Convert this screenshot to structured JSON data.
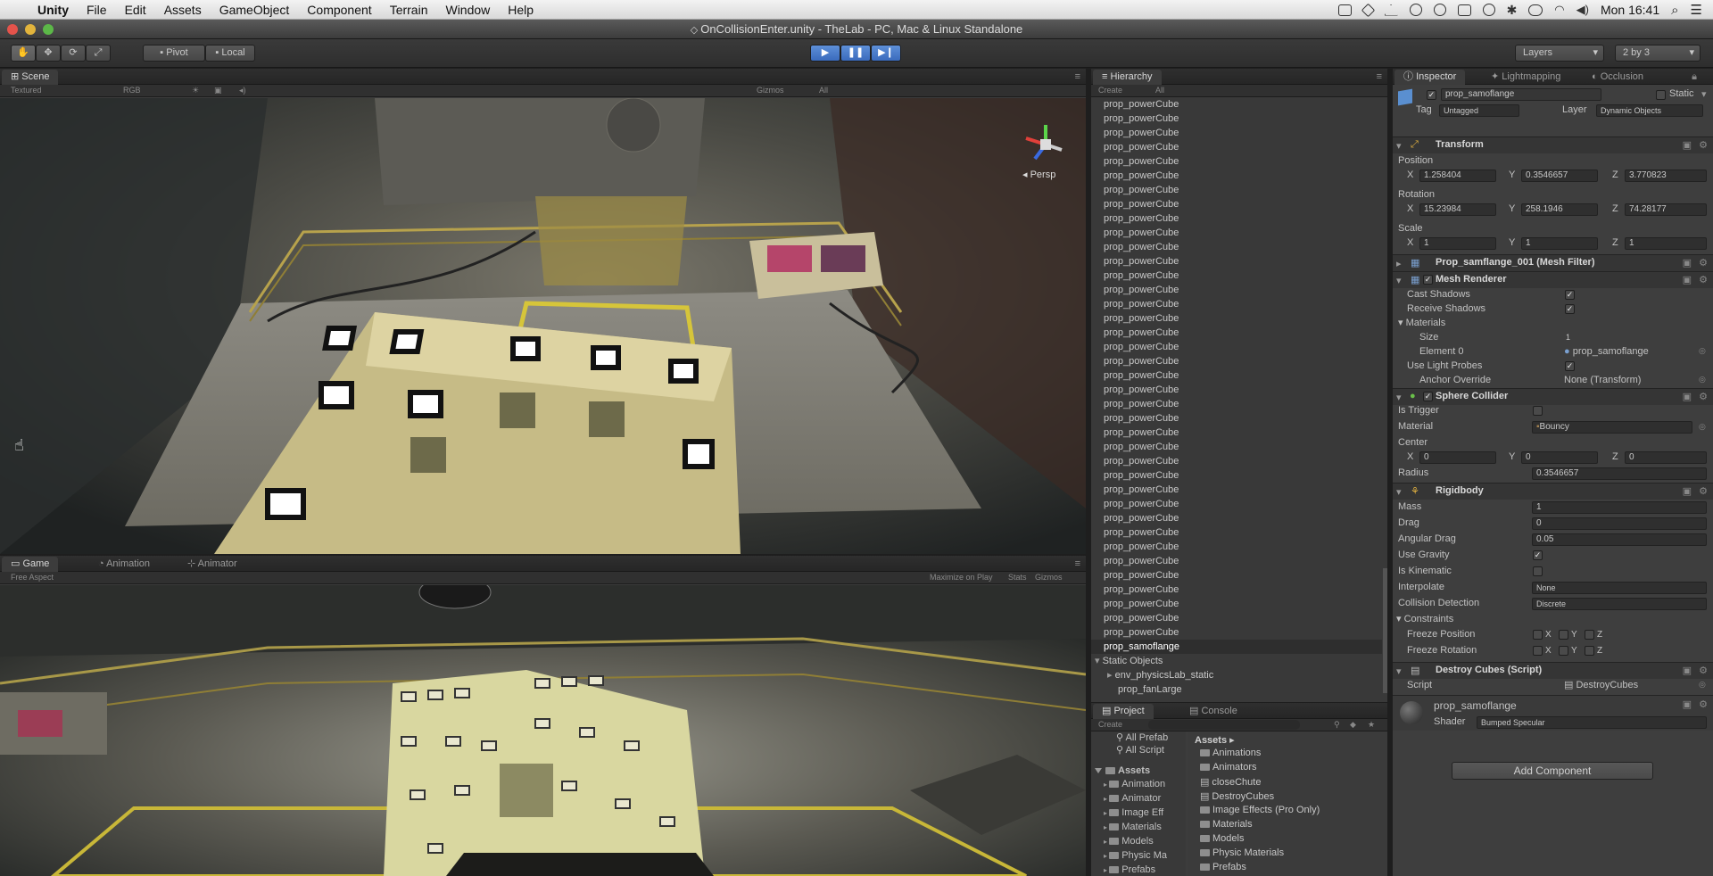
{
  "menubar": {
    "app": "Unity",
    "items": [
      "File",
      "Edit",
      "Assets",
      "GameObject",
      "Component",
      "Terrain",
      "Window",
      "Help"
    ],
    "clock": "Mon 16:41"
  },
  "window": {
    "title": "OnCollisionEnter.unity - TheLab - PC, Mac & Linux Standalone"
  },
  "toolbar": {
    "pivot": "Pivot",
    "local": "Local",
    "layers": "Layers",
    "layout": "2 by 3"
  },
  "scene": {
    "tab": "Scene",
    "render_mode": "Textured",
    "color_mode": "RGB",
    "gizmos": "Gizmos",
    "search": "All",
    "persp": "Persp"
  },
  "game": {
    "tabs": [
      "Game",
      "Animation",
      "Animator"
    ],
    "aspect": "Free Aspect",
    "maximize": "Maximize on Play",
    "stats": "Stats",
    "gizmos": "Gizmos"
  },
  "hierarchy": {
    "tab": "Hierarchy",
    "create": "Create",
    "search": "All",
    "items": [
      "prop_powerCube",
      "prop_powerCube",
      "prop_powerCube",
      "prop_powerCube",
      "prop_powerCube",
      "prop_powerCube",
      "prop_powerCube",
      "prop_powerCube",
      "prop_powerCube",
      "prop_powerCube",
      "prop_powerCube",
      "prop_powerCube",
      "prop_powerCube",
      "prop_powerCube",
      "prop_powerCube",
      "prop_powerCube",
      "prop_powerCube",
      "prop_powerCube",
      "prop_powerCube",
      "prop_powerCube",
      "prop_powerCube",
      "prop_powerCube",
      "prop_powerCube",
      "prop_powerCube",
      "prop_powerCube",
      "prop_powerCube",
      "prop_powerCube",
      "prop_powerCube",
      "prop_powerCube",
      "prop_powerCube",
      "prop_powerCube",
      "prop_powerCube",
      "prop_powerCube",
      "prop_powerCube",
      "prop_powerCube",
      "prop_powerCube",
      "prop_powerCube",
      "prop_powerCube"
    ],
    "selected": "prop_samoflange",
    "static_group": "Static Objects",
    "static_children": [
      "env_physicsLab_static",
      "prop_fanLarge"
    ]
  },
  "project": {
    "tabs": [
      "Project",
      "Console"
    ],
    "create": "Create",
    "favorites": [
      "All Prefab",
      "All Script"
    ],
    "tree_root": "Assets",
    "tree": [
      "Animation",
      "Animator",
      "Image Eff",
      "Materials",
      "Models",
      "Physic Ma",
      "Prefabs"
    ],
    "breadcrumb": "Assets",
    "files": [
      "Animations",
      "Animators",
      "closeChute",
      "DestroyCubes",
      "Image Effects (Pro Only)",
      "Materials",
      "Models",
      "Physic Materials",
      "Prefabs"
    ]
  },
  "inspector": {
    "tabs": [
      "Inspector",
      "Lightmapping",
      "Occlusion"
    ],
    "object_name": "prop_samoflange",
    "static": "Static",
    "tag_label": "Tag",
    "tag": "Untagged",
    "layer_label": "Layer",
    "layer": "Dynamic Objects",
    "transform": {
      "title": "Transform",
      "position_label": "Position",
      "position": {
        "x": "1.258404",
        "y": "0.3546657",
        "z": "3.770823"
      },
      "rotation_label": "Rotation",
      "rotation": {
        "x": "15.23984",
        "y": "258.1946",
        "z": "74.28177"
      },
      "scale_label": "Scale",
      "scale": {
        "x": "1",
        "y": "1",
        "z": "1"
      }
    },
    "mesh_filter": "Prop_samflange_001 (Mesh Filter)",
    "mesh_renderer": {
      "title": "Mesh Renderer",
      "cast_shadows": "Cast Shadows",
      "receive_shadows": "Receive Shadows",
      "materials": "Materials",
      "size_label": "Size",
      "size": "1",
      "element0_label": "Element 0",
      "element0": "prop_samoflange",
      "light_probes": "Use Light Probes",
      "anchor_label": "Anchor Override",
      "anchor": "None (Transform)"
    },
    "sphere_collider": {
      "title": "Sphere Collider",
      "is_trigger": "Is Trigger",
      "material_label": "Material",
      "material": "Bouncy",
      "center_label": "Center",
      "center": {
        "x": "0",
        "y": "0",
        "z": "0"
      },
      "radius_label": "Radius",
      "radius": "0.3546657"
    },
    "rigidbody": {
      "title": "Rigidbody",
      "mass_label": "Mass",
      "mass": "1",
      "drag_label": "Drag",
      "drag": "0",
      "angular_label": "Angular Drag",
      "angular": "0.05",
      "gravity_label": "Use Gravity",
      "kinematic_label": "Is Kinematic",
      "interpolate_label": "Interpolate",
      "interpolate": "None",
      "collision_label": "Collision Detection",
      "collision": "Discrete",
      "constraints": "Constraints",
      "freeze_pos": "Freeze Position",
      "freeze_rot": "Freeze Rotation"
    },
    "script": {
      "title": "Destroy Cubes (Script)",
      "script_label": "Script",
      "script": "DestroyCubes"
    },
    "material": {
      "name": "prop_samoflange",
      "shader_label": "Shader",
      "shader": "Bumped Specular"
    },
    "add_component": "Add Component"
  },
  "colors": {
    "accent": "#3a72c9",
    "bg": "#3c3c3c"
  }
}
